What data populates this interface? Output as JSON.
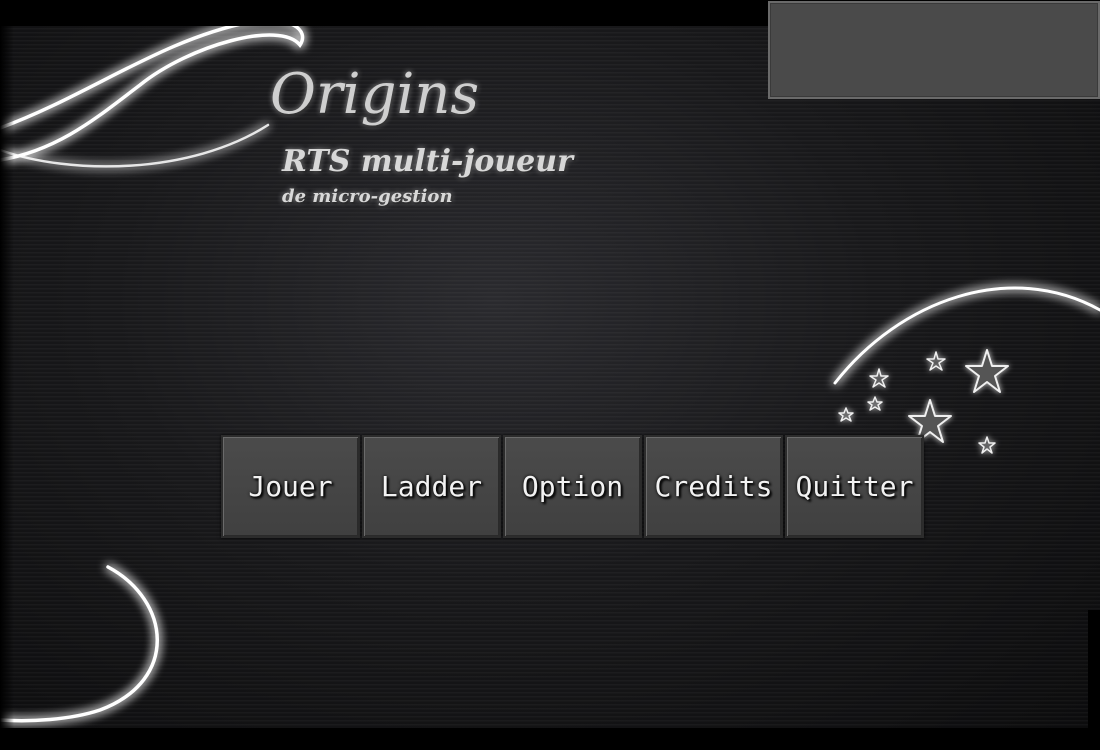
{
  "game": {
    "title": "Origins",
    "subtitle": "RTS multi-joueur",
    "tagline": "de micro-gestion"
  },
  "menu": {
    "items": [
      {
        "label": "Jouer"
      },
      {
        "label": "Ladder"
      },
      {
        "label": "Option"
      },
      {
        "label": "Credits"
      },
      {
        "label": "Quitter"
      }
    ]
  },
  "decoration": {
    "swirl_color": "#ffffff",
    "star_color": "#e8e8e8",
    "icons": [
      "swirl-icon",
      "star-icon"
    ]
  },
  "theme": {
    "background": "#1c1c1e",
    "button_bg": "#444444",
    "button_text": "#f2f2f2",
    "panel_bg": "#4a4a4a"
  }
}
